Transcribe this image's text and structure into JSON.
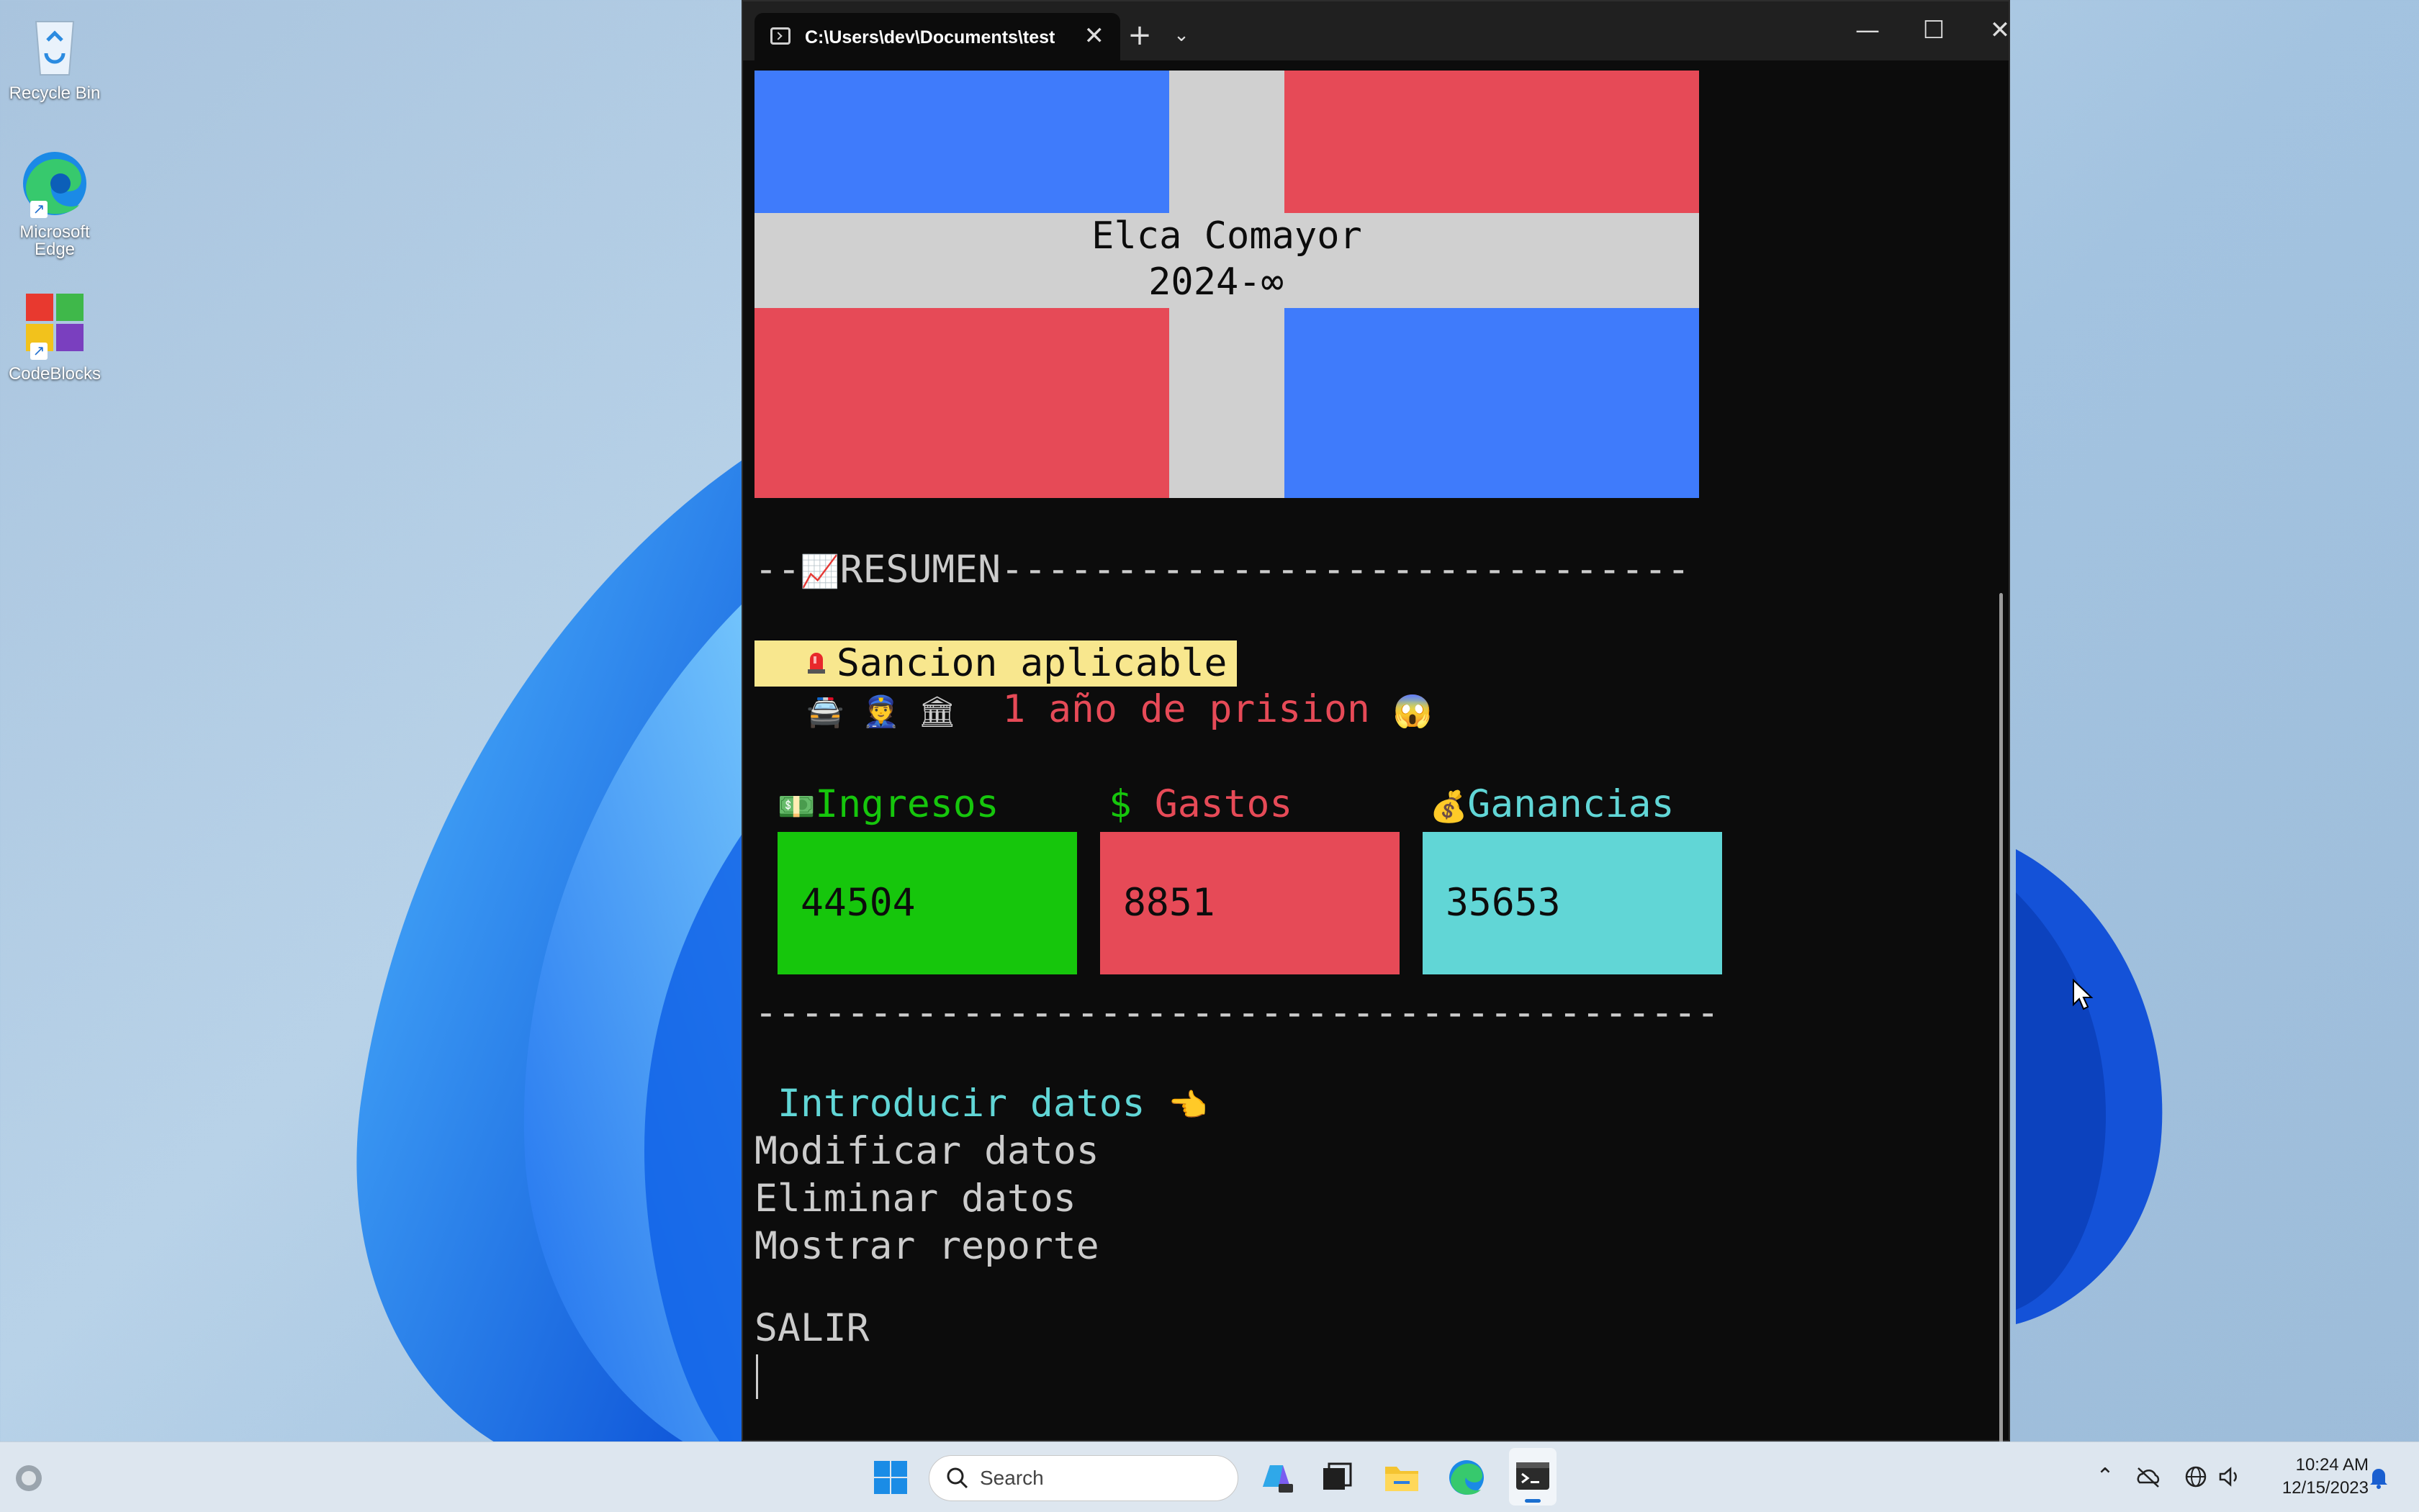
{
  "desktop": {
    "icons": [
      {
        "label": "Recycle Bin",
        "icon": "recycle-bin-icon"
      },
      {
        "label": "Microsoft Edge",
        "icon": "edge-icon"
      },
      {
        "label": "CodeBlocks",
        "icon": "codeblocks-icon"
      }
    ]
  },
  "terminal": {
    "tab_title": "C:\\Users\\dev\\Documents\\test",
    "close_tab": "✕",
    "new_tab": "+",
    "dropdown": "⌄",
    "buttons": {
      "minimize": "—",
      "maximize": "☐",
      "close": "✕"
    },
    "flag": {
      "colors": {
        "blue": "#3f7bfb",
        "red": "#e64a57",
        "white": "#d0d0d0"
      },
      "title_line1": "Elca Comayor",
      "title_line2": "2024-∞"
    },
    "resumen": {
      "prefix": "--",
      "emoji": "📈",
      "label": "RESUMEN",
      "dashes": "------------------------------"
    },
    "sancion": {
      "label": "Sancion aplicable",
      "detail_emojis": "🚔 👮 🏛",
      "detail_text": "1 año de prision",
      "detail_emoji_end": "😱"
    },
    "stats": {
      "ingresos": {
        "emoji": "💵",
        "label": "Ingresos",
        "value": "44504",
        "color": "#16c60c"
      },
      "gastos": {
        "emoji": "$",
        "label": "Gastos",
        "value": "8851",
        "color": "#e64a57"
      },
      "ganancias": {
        "emoji": "💰",
        "label": "Ganancias",
        "value": "35653",
        "color": "#61d6d6"
      }
    },
    "bottom_dashes": "------------------------------------------",
    "menu": {
      "selected": "Introducir datos",
      "selected_emoji": "👈",
      "items": [
        "Modificar datos",
        "Eliminar datos",
        "Mostrar reporte"
      ],
      "exit": "SALIR"
    }
  },
  "taskbar": {
    "search_placeholder": "Search",
    "time": "10:24 AM",
    "date": "12/15/2023"
  }
}
